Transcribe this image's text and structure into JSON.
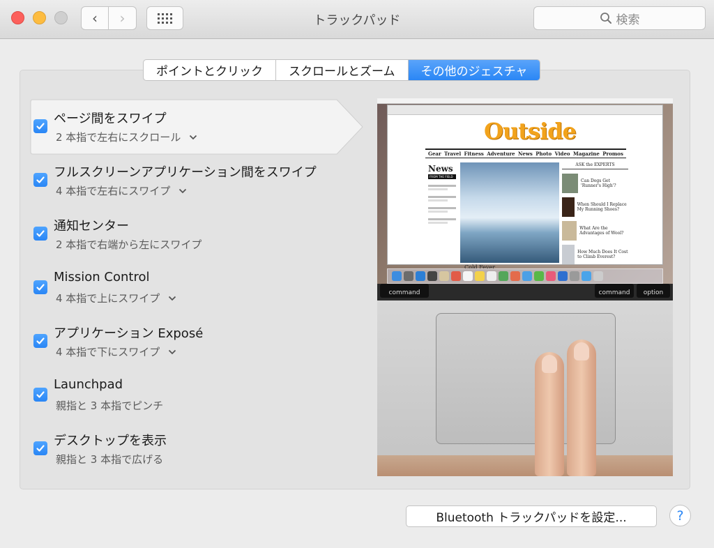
{
  "window": {
    "title": "トラックパッド"
  },
  "toolbar": {
    "back_glyph": "‹",
    "forward_glyph": "›",
    "search_placeholder": "検索",
    "search_icon": "search-icon",
    "grid_icon": "show-all-grid-icon"
  },
  "tabs": [
    {
      "label": "ポイントとクリック",
      "active": false
    },
    {
      "label": "スクロールとズーム",
      "active": false
    },
    {
      "label": "その他のジェスチャ",
      "active": true
    }
  ],
  "gestures": [
    {
      "title": "ページ間をスワイプ",
      "subtitle": "2 本指で左右にスクロール",
      "checked": true,
      "has_dropdown": true,
      "selected": true
    },
    {
      "title": "フルスクリーンアプリケーション間をスワイプ",
      "subtitle": "4 本指で左右にスワイプ",
      "checked": true,
      "has_dropdown": true,
      "selected": false
    },
    {
      "title": "通知センター",
      "subtitle": "2 本指で右端から左にスワイプ",
      "checked": true,
      "has_dropdown": false,
      "selected": false
    },
    {
      "title": "Mission Control",
      "subtitle": "4 本指で上にスワイプ",
      "checked": true,
      "has_dropdown": true,
      "selected": false
    },
    {
      "title": "アプリケーション Exposé",
      "subtitle": "4 本指で下にスワイプ",
      "checked": true,
      "has_dropdown": true,
      "selected": false
    },
    {
      "title": "Launchpad",
      "subtitle": "親指と 3 本指でピンチ",
      "checked": true,
      "has_dropdown": false,
      "selected": false
    },
    {
      "title": "デスクトップを表示",
      "subtitle": "親指と 3 本指で広げる",
      "checked": true,
      "has_dropdown": false,
      "selected": false
    }
  ],
  "preview": {
    "site_logo": "Outside",
    "nav": [
      "Gear",
      "Travel",
      "Fitness",
      "Adventure",
      "News",
      "Photo",
      "Video",
      "Magazine",
      "Promos"
    ],
    "news_heading": "News",
    "news_tag": "FROM THE FIELD",
    "hero_caption": "Cold Fever",
    "experts_heading": "ASK the EXPERTS",
    "experts": [
      "Can Dogs Get 'Runner's High'?",
      "When Should I Replace My Running Shoes?",
      "What Are the Advantages of Wool?",
      "How Much Does It Cost to Climb Everest?"
    ],
    "keys": [
      "command",
      "command",
      "option"
    ]
  },
  "footer": {
    "bluetooth_button": "Bluetooth トラックパッドを設定...",
    "help_label": "?"
  },
  "colors": {
    "accent": "#2a86f5",
    "close": "#fc605c",
    "minimize": "#fdbc40",
    "zoom_disabled": "#cfcfcf"
  }
}
